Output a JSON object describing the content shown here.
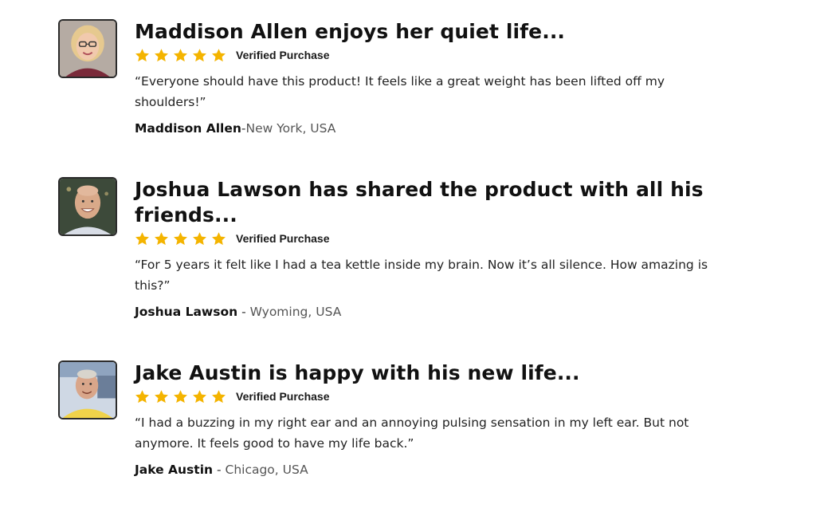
{
  "colors": {
    "star": "#F4B400",
    "title": "#111111",
    "text": "#222222",
    "location": "#555555"
  },
  "reviews": [
    {
      "title": "Maddison Allen enjoys her quiet life...",
      "stars": 5,
      "verified_label": "Verified Purchase",
      "quote": "“Everyone should have this product! It feels like a great weight has been lifted off my shoulders!”",
      "author_name": "Maddison Allen",
      "separator": "-",
      "location": "New York, USA",
      "avatar_icon": "woman-with-glasses-photo"
    },
    {
      "title": "Joshua Lawson has shared the product with all his friends...",
      "stars": 5,
      "verified_label": "Verified Purchase",
      "quote": "“For 5 years it felt like I had a tea kettle inside my brain. Now it’s all silence. How amazing is this?”",
      "author_name": "Joshua Lawson",
      "separator": " - ",
      "location": "Wyoming, USA",
      "avatar_icon": "bald-man-smiling-photo"
    },
    {
      "title": "Jake Austin is happy with his new life...",
      "stars": 5,
      "verified_label": "Verified Purchase",
      "quote": "“I had a buzzing in my right ear and an annoying pulsing sensation in my left ear. But not anymore. It feels good to have my life back.”",
      "author_name": "Jake Austin",
      "separator": " - ",
      "location": "Chicago, USA",
      "avatar_icon": "older-man-yellow-shirt-photo"
    }
  ]
}
